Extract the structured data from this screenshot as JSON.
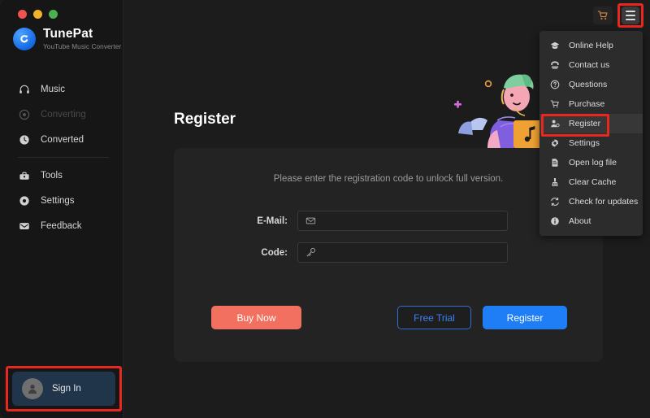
{
  "window": {
    "controls": [
      "close",
      "minimize",
      "maximize"
    ]
  },
  "brand": {
    "name": "TunePat",
    "subtitle": "YouTube Music Converter",
    "logo_icon": "tunepat-logo-icon"
  },
  "sidebar": {
    "items": [
      {
        "label": "Music",
        "icon": "headphones-icon",
        "state": "enabled"
      },
      {
        "label": "Converting",
        "icon": "converting-icon",
        "state": "disabled"
      },
      {
        "label": "Converted",
        "icon": "clock-icon",
        "state": "enabled"
      },
      {
        "label": "Tools",
        "icon": "toolbox-icon",
        "state": "enabled"
      },
      {
        "label": "Settings",
        "icon": "gear-icon",
        "state": "enabled"
      },
      {
        "label": "Feedback",
        "icon": "mail-icon",
        "state": "enabled"
      }
    ],
    "sign_in": {
      "label": "Sign In",
      "icon": "user-avatar-icon",
      "highlighted": true,
      "highlight_color": "#e8271f"
    }
  },
  "topbar": {
    "cart_icon": "shopping-cart-icon",
    "menu_icon": "hamburger-menu-icon",
    "menu_highlighted": true,
    "highlight_color": "#e8271f"
  },
  "main": {
    "title": "Register",
    "illustration_icon": "person-with-laptop-illustration",
    "card": {
      "hint": "Please enter the registration code to unlock full version.",
      "fields": [
        {
          "label": "E-Mail:",
          "icon": "envelope-icon",
          "value": "",
          "placeholder": ""
        },
        {
          "label": "Code:",
          "icon": "key-icon",
          "value": "",
          "placeholder": ""
        }
      ],
      "buttons": {
        "buy_now": "Buy Now",
        "free_trial": "Free Trial",
        "register": "Register"
      }
    }
  },
  "dropdown": {
    "items": [
      {
        "label": "Online Help",
        "icon": "graduation-cap-icon",
        "active": false
      },
      {
        "label": "Contact us",
        "icon": "telephone-icon",
        "active": false
      },
      {
        "label": "Questions",
        "icon": "question-mark-icon",
        "active": false
      },
      {
        "label": "Purchase",
        "icon": "shopping-cart-icon",
        "active": false
      },
      {
        "label": "Register",
        "icon": "user-register-icon",
        "active": true
      },
      {
        "label": "Settings",
        "icon": "gear-icon",
        "active": false
      },
      {
        "label": "Open log file",
        "icon": "document-icon",
        "active": false
      },
      {
        "label": "Clear Cache",
        "icon": "broom-icon",
        "active": false
      },
      {
        "label": "Check for updates",
        "icon": "refresh-icon",
        "active": false
      },
      {
        "label": "About",
        "icon": "info-icon",
        "active": false
      }
    ],
    "highlighted_item": "Register"
  },
  "colors": {
    "accent_blue": "#1f7ef5",
    "buy_now_red": "#f2705f",
    "highlight_red": "#e8271f",
    "app_bg": "#1c1c1c",
    "sidebar_bg": "#161616",
    "card_bg": "#232323",
    "menu_bg": "#2c2c2c"
  }
}
